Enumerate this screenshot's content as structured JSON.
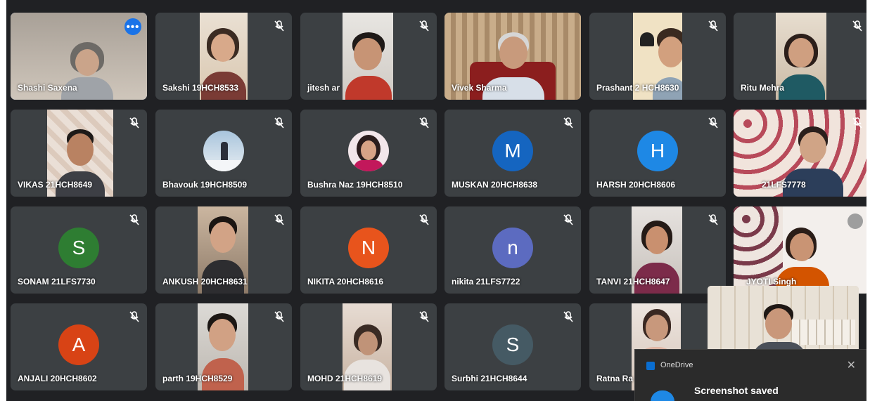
{
  "participants": [
    {
      "name": "Shashi Saxena",
      "active": true
    },
    {
      "name": "Sakshi 19HCH8533"
    },
    {
      "name": "jitesh ar"
    },
    {
      "name": "Vivek Sharma"
    },
    {
      "name": "Prashant 2 HCH8630"
    },
    {
      "name": "Ritu Mehra"
    },
    {
      "name": "VIKAS 21HCH8649"
    },
    {
      "name": "Bhavouk 19HCH8509"
    },
    {
      "name": "Bushra Naz 19HCH8510"
    },
    {
      "name": "MUSKAN 20HCH8638",
      "initial": "M"
    },
    {
      "name": "HARSH 20HCH8606",
      "initial": "H"
    },
    {
      "name": "21LFS7778"
    },
    {
      "name": "SONAM 21LFS7730",
      "initial": "S"
    },
    {
      "name": "ANKUSH 20HCH8631"
    },
    {
      "name": "NIKITA 20HCH8616",
      "initial": "N"
    },
    {
      "name": "nikita 21LFS7722",
      "initial": "n"
    },
    {
      "name": "TANVI 21HCH8647"
    },
    {
      "name": "JYOTI Singh"
    },
    {
      "name": "ANJALI 20HCH8602",
      "initial": "A"
    },
    {
      "name": "parth 19HCH8529"
    },
    {
      "name": "MOHD 21HCH8619"
    },
    {
      "name": "Surbhi 21HCH8644",
      "initial": "S"
    },
    {
      "name": "Ratna Ra"
    }
  ],
  "more_options": "•••",
  "notification": {
    "app": "OneDrive",
    "message": "Screenshot saved",
    "close": "✕"
  },
  "colors": {
    "background": "#202124",
    "tile": "#3c4043",
    "active_outline": "#8ab4f8",
    "avatar_muskan": "#1565c0",
    "avatar_harsh": "#1e88e5",
    "avatar_sonam": "#2e7d32",
    "avatar_nikita": "#e8541c",
    "avatar_nikita_lower": "#5c6bc0",
    "avatar_anjali": "#d84315",
    "avatar_surbhi": "#455a64"
  }
}
